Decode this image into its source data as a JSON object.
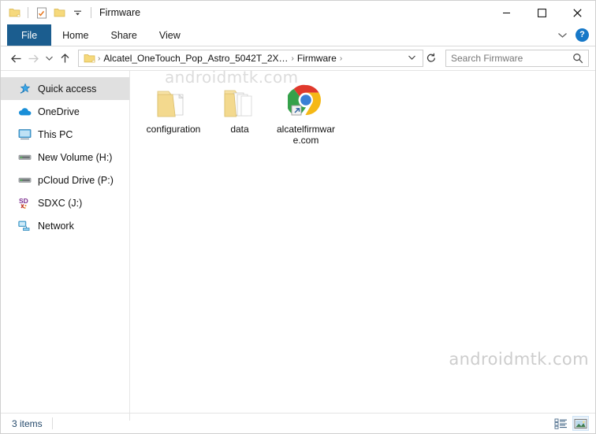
{
  "window": {
    "title": "Firmware",
    "quick_access_toolbar": [
      {
        "name": "folder-icon",
        "label": "Explorer"
      },
      {
        "name": "properties-icon",
        "label": "Properties"
      },
      {
        "name": "new-folder-icon",
        "label": "New folder"
      },
      {
        "name": "chevron-down-icon",
        "label": "Customize Quick Access Toolbar"
      }
    ],
    "controls": {
      "minimize": "—",
      "maximize": "☐",
      "close": "✕"
    }
  },
  "ribbon": {
    "tabs": [
      {
        "label": "File",
        "active": true
      },
      {
        "label": "Home",
        "active": false
      },
      {
        "label": "Share",
        "active": false
      },
      {
        "label": "View",
        "active": false
      }
    ],
    "expand_label": "⌄",
    "help_label": "?"
  },
  "address_bar": {
    "back_label": "←",
    "forward_label": "→",
    "recent_label": "⌄",
    "up_label": "↑",
    "crumbs": [
      "Alcatel_OneTouch_Pop_Astro_5042T_2X…",
      "Firmware"
    ],
    "crumb_separator": "›",
    "dropdown_label": "⌄",
    "refresh_label": "↻"
  },
  "search": {
    "placeholder": "Search Firmware",
    "value": "",
    "icon_label": "⌕"
  },
  "sidebar": {
    "items": [
      {
        "label": "Quick access",
        "icon": "star-icon",
        "selected": true
      },
      {
        "label": "OneDrive",
        "icon": "cloud-icon",
        "selected": false
      },
      {
        "label": "This PC",
        "icon": "monitor-icon",
        "selected": false
      },
      {
        "label": "New Volume (H:)",
        "icon": "drive-icon",
        "selected": false
      },
      {
        "label": "pCloud Drive (P:)",
        "icon": "drive-icon",
        "selected": false
      },
      {
        "label": "SDXC (J:)",
        "icon": "sd-card-icon",
        "selected": false
      },
      {
        "label": "Network",
        "icon": "network-icon",
        "selected": false
      }
    ]
  },
  "content": {
    "items": [
      {
        "label": "configuration",
        "type": "folder-with-document",
        "icon": "folder-icon"
      },
      {
        "label": "data",
        "type": "folder-with-documents",
        "icon": "folder-icon"
      },
      {
        "label": "alcatelfirmware.com",
        "type": "shortcut",
        "icon": "chrome-icon"
      }
    ]
  },
  "watermarks": {
    "top": "androidmtk.com",
    "bottom": "androidmtk.com"
  },
  "status_bar": {
    "item_count": "3 items",
    "view_buttons": [
      {
        "name": "details-view-button",
        "label": "Details view",
        "active": false
      },
      {
        "name": "large-icons-view-button",
        "label": "Large icons view",
        "active": true
      }
    ]
  },
  "colors": {
    "file_tab": "#1b5d8f",
    "selection": "#e0e0e0",
    "status_text": "#24496b",
    "help_blue": "#1678c8",
    "folder_yellow": "#f5d67b",
    "watermark": "#d2d2d2"
  }
}
